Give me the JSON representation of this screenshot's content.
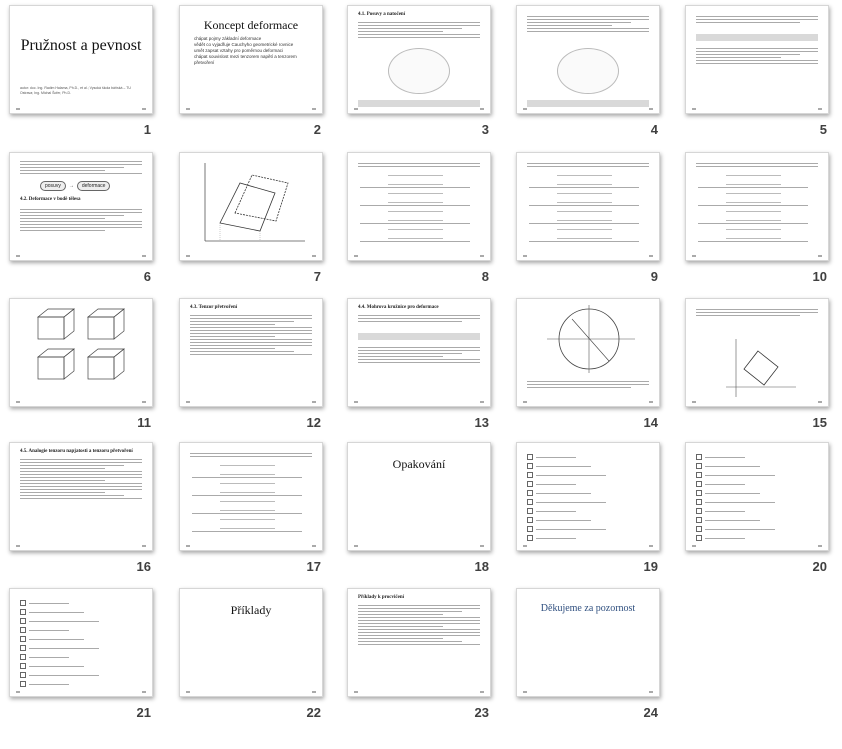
{
  "slides": [
    {
      "n": "1",
      "kind": "title",
      "title": "Pružnost a pevnost",
      "subtitle": "autor: doc. Ing. Radim Halama, Ph.D., et al.; Vysoká škola báňská – TU Ostrava; Ing. Michal Šofer, Ph.D."
    },
    {
      "n": "2",
      "kind": "concept",
      "title": "Koncept deformace",
      "bullets": [
        "chápat pojmy základní deformace",
        "vědět co vyjadřuje Cauchyho geometrické rovnice",
        "umět zapsat vztahy pro poměrnou deformaci",
        "chápat souvislost mezi tenzorem napětí a tenzorem přetvoření"
      ]
    },
    {
      "n": "3",
      "kind": "text-fig",
      "heading": "4.1. Posuvy a natočení"
    },
    {
      "n": "4",
      "kind": "text-fig"
    },
    {
      "n": "5",
      "kind": "text-hl"
    },
    {
      "n": "6",
      "kind": "text-flow",
      "flow": [
        "posuvy",
        "deformace"
      ],
      "heading": "4.2. Deformace v bodě tělesa"
    },
    {
      "n": "7",
      "kind": "diagram"
    },
    {
      "n": "8",
      "kind": "equations"
    },
    {
      "n": "9",
      "kind": "equations"
    },
    {
      "n": "10",
      "kind": "equations"
    },
    {
      "n": "11",
      "kind": "cubes"
    },
    {
      "n": "12",
      "kind": "text",
      "heading": "4.3. Tenzor přetvoření"
    },
    {
      "n": "13",
      "kind": "text-hl",
      "heading": "4.4. Mohrova kružnice pro deformace"
    },
    {
      "n": "14",
      "kind": "circle"
    },
    {
      "n": "15",
      "kind": "rotated"
    },
    {
      "n": "16",
      "kind": "text",
      "heading": "4.5. Analogie tenzoru napjatosti a tenzoru přetvoření"
    },
    {
      "n": "17",
      "kind": "equations"
    },
    {
      "n": "18",
      "kind": "section",
      "title": "Opakování"
    },
    {
      "n": "19",
      "kind": "quiz"
    },
    {
      "n": "20",
      "kind": "quiz"
    },
    {
      "n": "21",
      "kind": "quiz"
    },
    {
      "n": "22",
      "kind": "section",
      "title": "Příklady"
    },
    {
      "n": "23",
      "kind": "text",
      "heading": "Příklady k procvičení"
    },
    {
      "n": "24",
      "kind": "thanks",
      "title": "Děkujeme za pozornost"
    }
  ]
}
